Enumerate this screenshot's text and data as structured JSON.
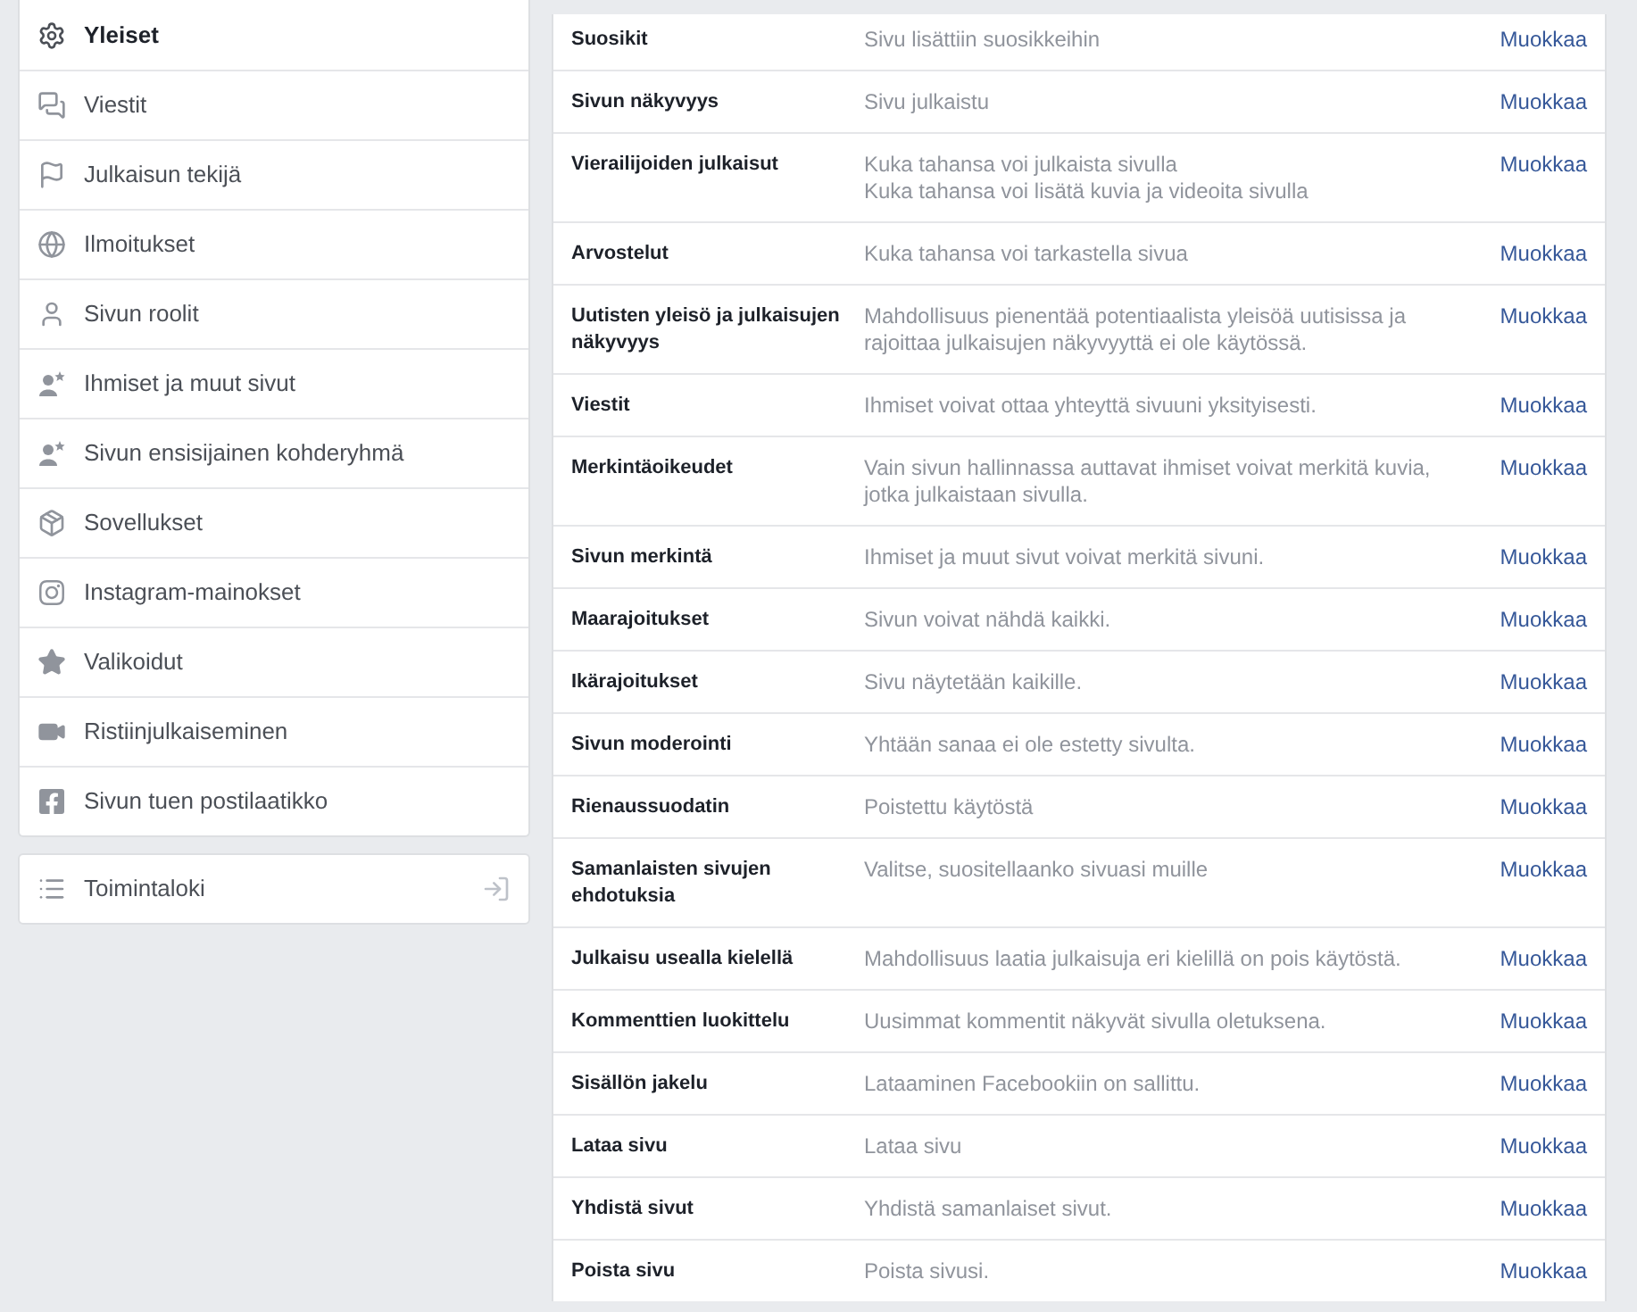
{
  "sidebar": {
    "items": [
      {
        "label": "Yleiset",
        "selected": true
      },
      {
        "label": "Viestit",
        "selected": false
      },
      {
        "label": "Julkaisun tekijä",
        "selected": false
      },
      {
        "label": "Ilmoitukset",
        "selected": false
      },
      {
        "label": "Sivun roolit",
        "selected": false
      },
      {
        "label": "Ihmiset ja muut sivut",
        "selected": false
      },
      {
        "label": "Sivun ensisijainen kohderyhmä",
        "selected": false
      },
      {
        "label": "Sovellukset",
        "selected": false
      },
      {
        "label": "Instagram-mainokset",
        "selected": false
      },
      {
        "label": "Valikoidut",
        "selected": false
      },
      {
        "label": "Ristiinjulkaiseminen",
        "selected": false
      },
      {
        "label": "Sivun tuen postilaatikko",
        "selected": false
      }
    ],
    "activity_log": {
      "label": "Toimintaloki"
    }
  },
  "settings": {
    "rows": [
      {
        "label": "Suosikit",
        "value": [
          "Sivu lisättiin suosikkeihin"
        ],
        "action": "Muokkaa"
      },
      {
        "label": "Sivun näkyvyys",
        "value": [
          "Sivu julkaistu"
        ],
        "action": "Muokkaa"
      },
      {
        "label": "Vierailijoiden julkaisut",
        "value": [
          "Kuka tahansa voi julkaista sivulla",
          "Kuka tahansa voi lisätä kuvia ja videoita sivulla"
        ],
        "action": "Muokkaa"
      },
      {
        "label": "Arvostelut",
        "value": [
          "Kuka tahansa voi tarkastella sivua"
        ],
        "action": "Muokkaa"
      },
      {
        "label": "Uutisten yleisö ja julkaisujen näkyvyys",
        "value": [
          "Mahdollisuus pienentää potentiaalista yleisöä uutisissa ja rajoittaa julkaisujen näkyvyyttä ei ole käytössä."
        ],
        "action": "Muokkaa"
      },
      {
        "label": "Viestit",
        "value": [
          "Ihmiset voivat ottaa yhteyttä sivuuni yksityisesti."
        ],
        "action": "Muokkaa"
      },
      {
        "label": "Merkintäoikeudet",
        "value": [
          "Vain sivun hallinnassa auttavat ihmiset voivat merkitä kuvia, jotka julkaistaan sivulla."
        ],
        "action": "Muokkaa"
      },
      {
        "label": "Sivun merkintä",
        "value": [
          "Ihmiset ja muut sivut voivat merkitä sivuni."
        ],
        "action": "Muokkaa"
      },
      {
        "label": "Maarajoitukset",
        "value": [
          "Sivun voivat nähdä kaikki."
        ],
        "action": "Muokkaa"
      },
      {
        "label": "Ikärajoitukset",
        "value": [
          "Sivu näytetään kaikille."
        ],
        "action": "Muokkaa"
      },
      {
        "label": "Sivun moderointi",
        "value": [
          "Yhtään sanaa ei ole estetty sivulta."
        ],
        "action": "Muokkaa"
      },
      {
        "label": "Rienaussuodatin",
        "value": [
          "Poistettu käytöstä"
        ],
        "action": "Muokkaa"
      },
      {
        "label": "Samanlaisten sivujen ehdotuksia",
        "value": [
          "Valitse, suositellaanko sivuasi muille"
        ],
        "action": "Muokkaa"
      },
      {
        "label": "Julkaisu usealla kielellä",
        "value": [
          "Mahdollisuus laatia julkaisuja eri kielillä on pois käytöstä."
        ],
        "action": "Muokkaa"
      },
      {
        "label": "Kommenttien luokittelu",
        "value": [
          "Uusimmat kommentit näkyvät sivulla oletuksena."
        ],
        "action": "Muokkaa"
      },
      {
        "label": "Sisällön jakelu",
        "value": [
          "Lataaminen Facebookiin on sallittu."
        ],
        "action": "Muokkaa"
      },
      {
        "label": "Lataa sivu",
        "value": [
          "Lataa sivu"
        ],
        "action": "Muokkaa"
      },
      {
        "label": "Yhdistä sivut",
        "value": [
          "Yhdistä samanlaiset sivut."
        ],
        "action": "Muokkaa"
      },
      {
        "label": "Poista sivu",
        "value": [
          "Poista sivusi."
        ],
        "action": "Muokkaa"
      }
    ]
  }
}
